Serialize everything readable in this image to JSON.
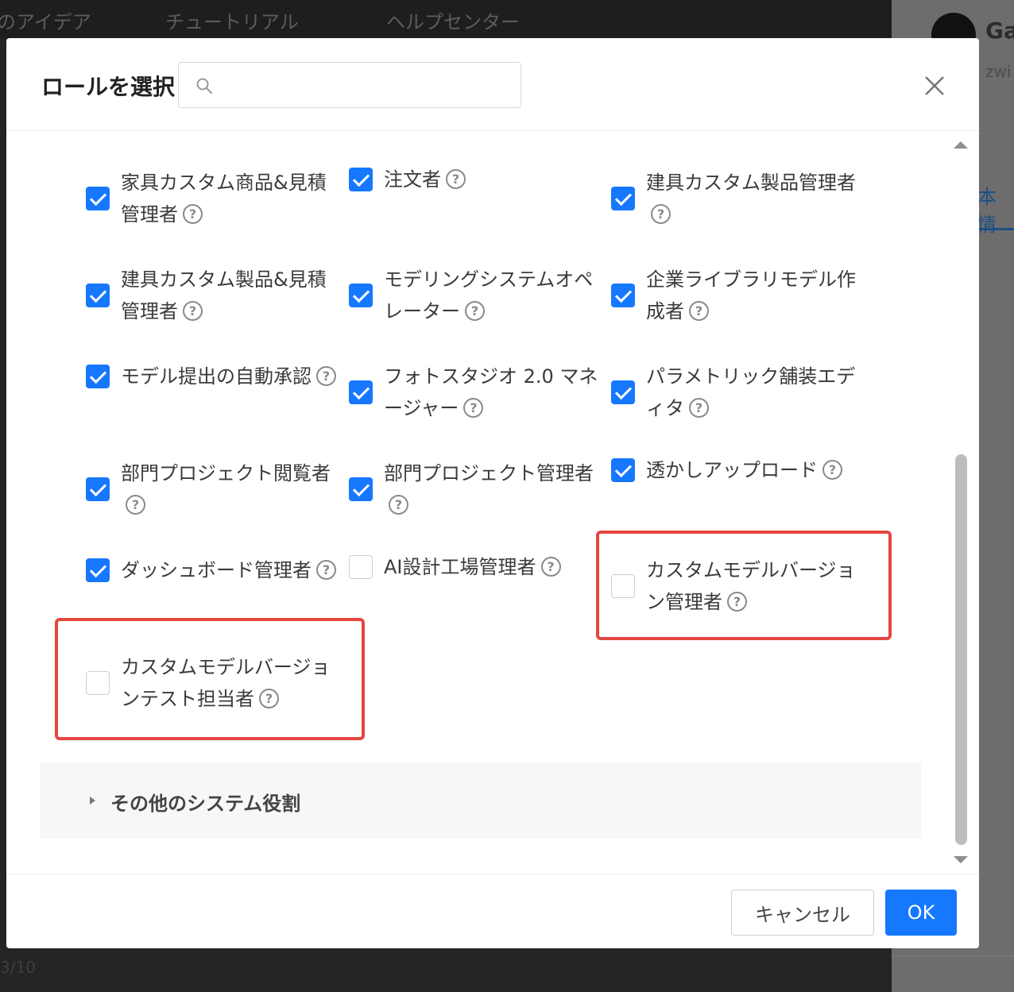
{
  "background": {
    "nav_items": [
      "のアイデア",
      "チュートリアル",
      "ヘルプセンター"
    ],
    "user_name": "Ga",
    "user_sub": "zwi",
    "tab_label": "本情",
    "pager": "3/10"
  },
  "modal": {
    "title": "ロールを選択",
    "search": {
      "value": "",
      "placeholder": ""
    },
    "roles": [
      {
        "label": "家具カスタム商品&見積管理者",
        "checked": true
      },
      {
        "label": "注文者",
        "checked": true
      },
      {
        "label": "建具カスタム製品管理者",
        "checked": true
      },
      {
        "label": "建具カスタム製品&見積管理者",
        "checked": true
      },
      {
        "label": "モデリングシステムオペレーター",
        "checked": true
      },
      {
        "label": "企業ライブラリモデル作成者",
        "checked": true
      },
      {
        "label": "モデル提出の自動承認",
        "checked": true
      },
      {
        "label": "フォトスタジオ 2.0 マネージャー",
        "checked": true
      },
      {
        "label": "パラメトリック舗装エディタ",
        "checked": true
      },
      {
        "label": "部門プロジェクト閲覧者",
        "checked": true
      },
      {
        "label": "部門プロジェクト管理者",
        "checked": true
      },
      {
        "label": "透かしアップロード",
        "checked": true
      },
      {
        "label": "ダッシュボード管理者",
        "checked": true
      },
      {
        "label": "AI設計工場管理者",
        "checked": false
      },
      {
        "label": "カスタムモデルバージョン管理者",
        "checked": false
      },
      {
        "label": "カスタムモデルバージョンテスト担当者",
        "checked": false
      }
    ],
    "other_roles_label": "その他のシステム役割",
    "cancel_label": "キャンセル",
    "ok_label": "OK"
  },
  "colors": {
    "accent": "#1677ff",
    "highlight": "#e5473f"
  }
}
